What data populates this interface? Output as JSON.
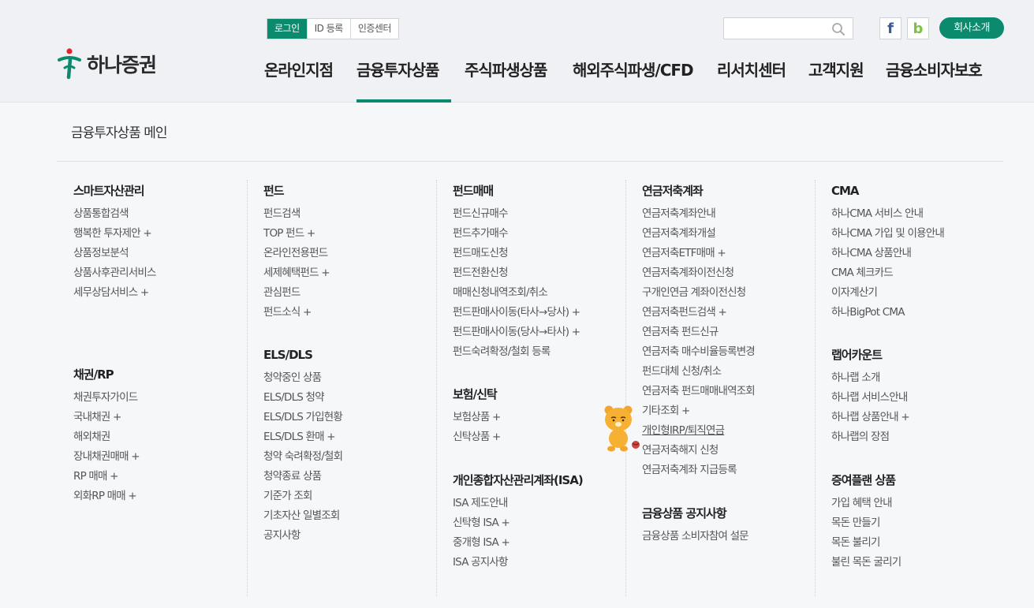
{
  "header": {
    "logo_text": "하나증권",
    "util": [
      "로그인",
      "ID 등록",
      "인증센터"
    ],
    "search_placeholder": "",
    "sns": [
      "f",
      "b"
    ],
    "company_label": "회사소개",
    "colors": {
      "accent": "#0b8a6d",
      "facebook": "#3b5998",
      "band": "#7cc241"
    }
  },
  "gnb": [
    "온라인지점",
    "금융투자상품",
    "주식파생상품",
    "해외주식파생/CFD",
    "리서치센터",
    "고객지원",
    "금융소비자보호"
  ],
  "gnb_active": "금융투자상품",
  "menu_title": "금융투자상품 메인",
  "columns": [
    [
      {
        "title": "스마트자산관리",
        "items": [
          "상품통합검색",
          "행복한 투자제안 +",
          "상품정보분석",
          "상품사후관리서비스",
          "세무상담서비스 +"
        ]
      },
      {
        "title": "채권/RP",
        "items": [
          "채권투자가이드",
          "국내채권 +",
          "해외채권",
          "장내채권매매 +",
          "RP 매매 +",
          "외화RP 매매 +"
        ]
      }
    ],
    [
      {
        "title": "펀드",
        "items": [
          "펀드검색",
          "TOP 펀드 +",
          "온라인전용펀드",
          "세제혜택펀드 +",
          "관심펀드",
          "펀드소식 +"
        ]
      },
      {
        "title": "ELS/DLS",
        "items": [
          "청약중인 상품",
          "ELS/DLS 청약",
          "ELS/DLS 가입현황",
          "ELS/DLS 환매 +",
          "청약 숙려확정/철회",
          "청약종료 상품",
          "기준가 조회",
          "기초자산 일별조회",
          "공지사항"
        ]
      }
    ],
    [
      {
        "title": "펀드매매",
        "items": [
          "펀드신규매수",
          "펀드추가매수",
          "펀드매도신청",
          "펀드전환신청",
          "매매신청내역조회/취소",
          "펀드판매사이동(타사→당사) +",
          "펀드판매사이동(당사→타사) +",
          "펀드숙려확정/철회 등록"
        ]
      },
      {
        "title": "보험/신탁",
        "items": [
          "보험상품 +",
          "신탁상품 +"
        ]
      },
      {
        "title": "개인종합자산관리계좌(ISA)",
        "items": [
          "ISA 제도안내",
          "신탁형 ISA +",
          "중개형 ISA +",
          "ISA 공지사항"
        ]
      }
    ],
    [
      {
        "title": "연금저축계좌",
        "items": [
          "연금저축계좌안내",
          "연금저축계좌개설",
          "연금저축ETF매매 +",
          "연금저축계좌이전신청",
          "구개인연금 계좌이전신청",
          "연금저축펀드검색 +",
          "연금저축 펀드신규",
          "연금저축 매수비율등록변경",
          "펀드대체 신청/취소",
          "연금저축 펀드매매내역조회",
          "기타조회 +",
          "개인형IRP/퇴직연금",
          "연금저축해지 신청",
          "연금저축계좌 지급등록"
        ]
      },
      {
        "title": "금융상품 공지사항",
        "items": [
          "금융상품 소비자참여 설문"
        ]
      }
    ],
    [
      {
        "title": "CMA",
        "items": [
          "하나CMA 서비스 안내",
          "하나CMA 가입 및 이용안내",
          "하나CMA 상품안내",
          "CMA 체크카드",
          "이자계산기",
          "하나BigPot CMA"
        ]
      },
      {
        "title": "랩어카운트",
        "items": [
          "하나랩 소개",
          "하나랩 서비스안내",
          "하나랩 상품안내 +",
          "하나랩의 장점"
        ]
      },
      {
        "title": "증여플랜 상품",
        "items": [
          "가입 혜택 안내",
          "목돈 만들기",
          "목돈 불리기",
          "불린 목돈 굴리기"
        ]
      }
    ]
  ]
}
